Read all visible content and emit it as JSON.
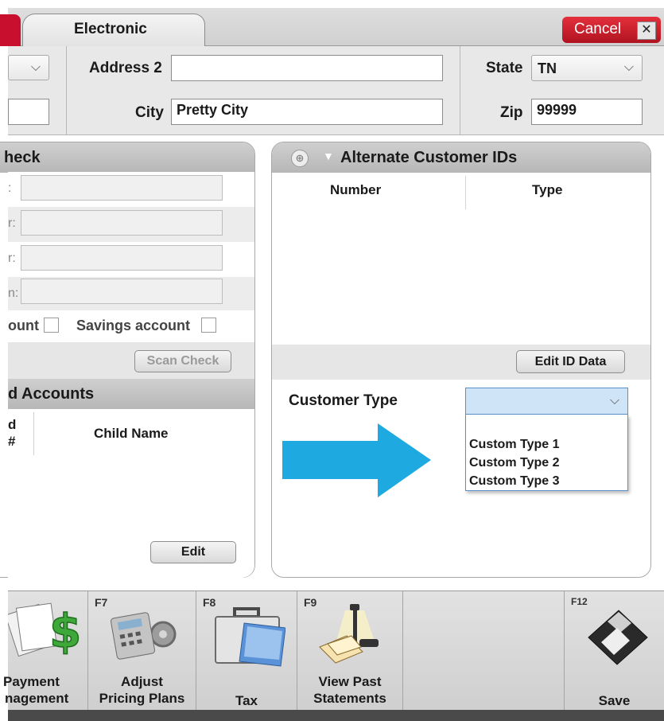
{
  "tabs": {
    "electronic_label": "Electronic",
    "cancel_label": "Cancel",
    "close_glyph": "x"
  },
  "address": {
    "address2_label": "Address 2",
    "address2_value": "",
    "city_label": "City",
    "city_value": "Pretty City",
    "state_label": "State",
    "state_value": "TN",
    "zip_label": "Zip",
    "zip_value": "99999"
  },
  "check_panel": {
    "title": "heck",
    "row_labels": [
      ":",
      "r:",
      "r:",
      "n:"
    ],
    "checking_label": "ount",
    "savings_label": "Savings account",
    "scan_button": "Scan Check"
  },
  "child_accounts": {
    "title": "d Accounts",
    "col_num_line1": "d",
    "col_num_line2": "#",
    "col_name": "Child Name",
    "edit_button": "Edit"
  },
  "alt_ids": {
    "title": "Alternate Customer IDs",
    "col_number": "Number",
    "col_type": "Type",
    "edit_button": "Edit ID Data"
  },
  "customer_type": {
    "label": "Customer Type",
    "selected": "",
    "options": [
      "Custom Type 1",
      "Custom Type 2",
      "Custom Type 3"
    ]
  },
  "toolbar": {
    "payment_line1": "Payment",
    "payment_line2": "nagement",
    "f7": "F7",
    "pricing_line1": "Adjust",
    "pricing_line2": "Pricing Plans",
    "f8": "F8",
    "tax": "Tax",
    "f9": "F9",
    "statements_line1": "View Past",
    "statements_line2": "Statements",
    "f12": "F12",
    "save": "Save"
  },
  "colors": {
    "accent_red": "#c8102e",
    "arrow_blue": "#1fa9e1",
    "dropdown_highlight": "#cfe4f7"
  }
}
